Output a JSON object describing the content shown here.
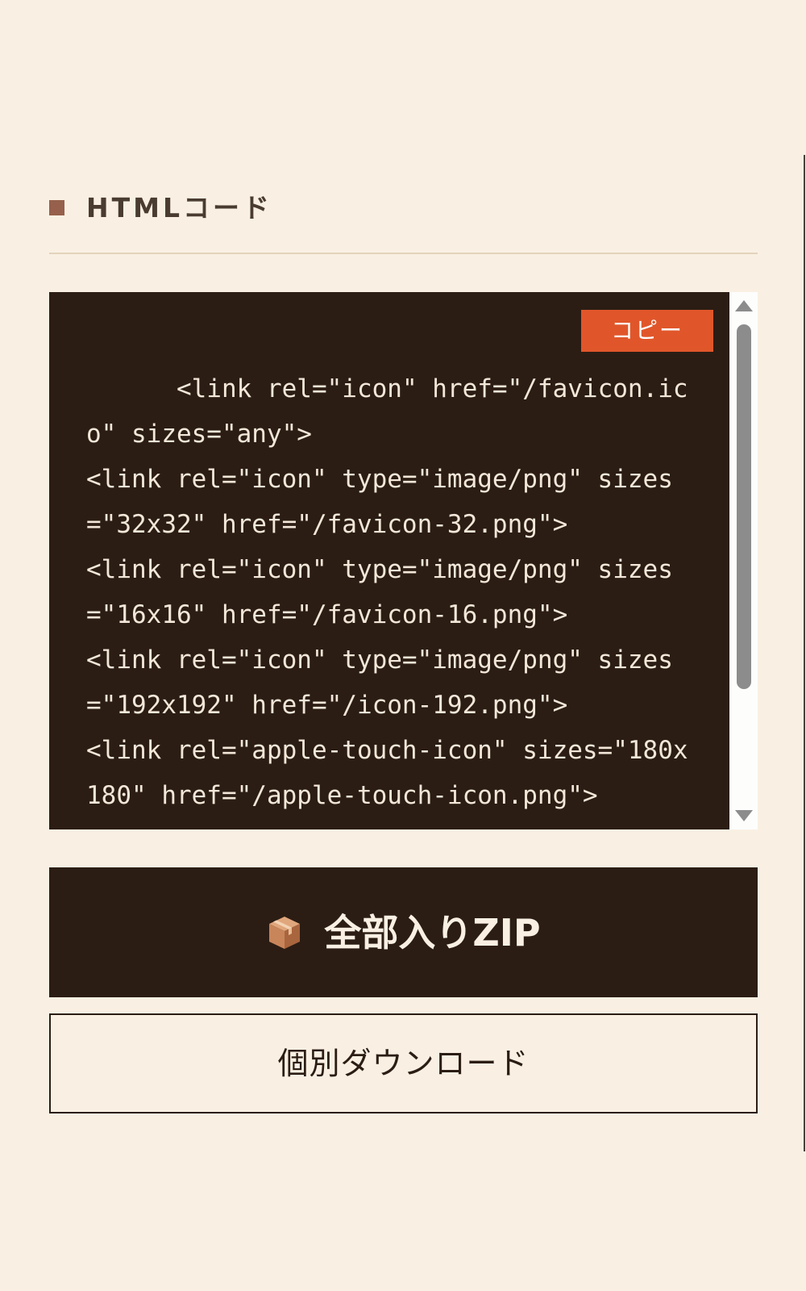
{
  "section": {
    "title": "HTMLコード"
  },
  "code": {
    "copy_label": "コピー",
    "content": "      <link rel=\"icon\" href=\"/favicon.ico\" sizes=\"any\">\n<link rel=\"icon\" type=\"image/png\" sizes=\"32x32\" href=\"/favicon-32.png\">\n<link rel=\"icon\" type=\"image/png\" sizes=\"16x16\" href=\"/favicon-16.png\">\n<link rel=\"icon\" type=\"image/png\" sizes=\"192x192\" href=\"/icon-192.png\">\n<link rel=\"apple-touch-icon\" sizes=\"180x180\" href=\"/apple-touch-icon.png\">"
  },
  "buttons": {
    "zip_icon": "package-box-icon",
    "zip_label": "全部入りZIP",
    "individual_label": "個別ダウンロード"
  },
  "colors": {
    "background": "#f9f0e3",
    "dark": "#2b1d14",
    "accent": "#e0562a",
    "marker": "#96604c"
  }
}
